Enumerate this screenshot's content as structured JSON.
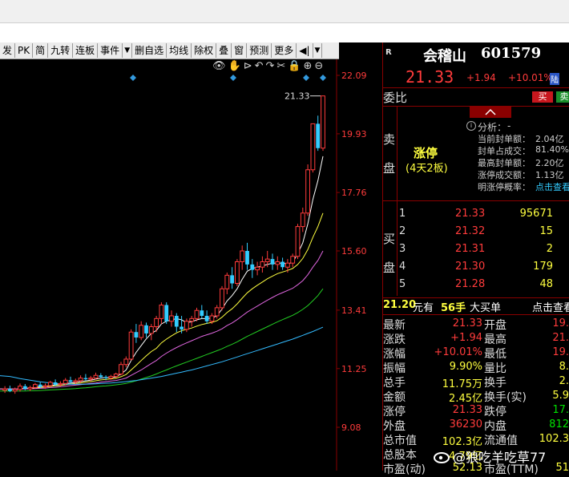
{
  "toolbar": {
    "items": [
      "发",
      "PK",
      "简",
      "九转",
      "连板",
      "事件",
      "▼",
      "删自选",
      "均线",
      "除权",
      "叠",
      "窗",
      "预测",
      "更多",
      "◀|",
      "▼"
    ]
  },
  "chart_tools": {
    "icons": [
      "eye-icon",
      "hand-icon",
      "play-icon",
      "undo-icon",
      "redo-icon",
      "scissors-icon",
      "lock-icon",
      "zoom-in-icon",
      "zoom-out-icon"
    ],
    "glyphs": [
      "👁",
      "✋",
      "⊳",
      "↶",
      "↷",
      "✂",
      "🔒",
      "⊕",
      "⊖"
    ]
  },
  "chart_data": {
    "type": "candlestick",
    "price_axis_ticks": [
      "22.09",
      "19.93",
      "17.76",
      "15.60",
      "13.41",
      "11.25",
      "9.08"
    ],
    "ylim": [
      9.08,
      22.09
    ],
    "high_label": "21.33",
    "candles": [
      {
        "o": 10.45,
        "h": 10.6,
        "l": 10.35,
        "c": 10.5
      },
      {
        "o": 10.5,
        "h": 10.62,
        "l": 10.38,
        "c": 10.42
      },
      {
        "o": 10.42,
        "h": 10.55,
        "l": 10.32,
        "c": 10.48
      },
      {
        "o": 10.48,
        "h": 10.7,
        "l": 10.4,
        "c": 10.6
      },
      {
        "o": 10.6,
        "h": 10.68,
        "l": 10.45,
        "c": 10.5
      },
      {
        "o": 10.5,
        "h": 10.62,
        "l": 10.42,
        "c": 10.55
      },
      {
        "o": 10.55,
        "h": 10.72,
        "l": 10.5,
        "c": 10.66
      },
      {
        "o": 10.66,
        "h": 10.75,
        "l": 10.52,
        "c": 10.58
      },
      {
        "o": 10.58,
        "h": 10.7,
        "l": 10.5,
        "c": 10.62
      },
      {
        "o": 10.62,
        "h": 10.8,
        "l": 10.55,
        "c": 10.74
      },
      {
        "o": 10.74,
        "h": 10.85,
        "l": 10.6,
        "c": 10.66
      },
      {
        "o": 10.66,
        "h": 10.78,
        "l": 10.58,
        "c": 10.7
      },
      {
        "o": 10.7,
        "h": 10.9,
        "l": 10.65,
        "c": 10.82
      },
      {
        "o": 10.82,
        "h": 10.95,
        "l": 10.7,
        "c": 10.76
      },
      {
        "o": 10.76,
        "h": 10.88,
        "l": 10.68,
        "c": 10.8
      },
      {
        "o": 10.8,
        "h": 11.0,
        "l": 10.72,
        "c": 10.9
      },
      {
        "o": 10.9,
        "h": 11.05,
        "l": 10.8,
        "c": 10.86
      },
      {
        "o": 10.86,
        "h": 10.98,
        "l": 10.78,
        "c": 10.9
      },
      {
        "o": 10.9,
        "h": 11.1,
        "l": 10.85,
        "c": 11.0
      },
      {
        "o": 11.0,
        "h": 11.08,
        "l": 10.88,
        "c": 10.94
      },
      {
        "o": 10.94,
        "h": 11.0,
        "l": 10.82,
        "c": 10.9
      },
      {
        "o": 10.9,
        "h": 11.02,
        "l": 10.84,
        "c": 10.96
      },
      {
        "o": 10.96,
        "h": 11.1,
        "l": 10.9,
        "c": 11.05
      },
      {
        "o": 11.05,
        "h": 11.5,
        "l": 11.0,
        "c": 11.4
      },
      {
        "o": 11.4,
        "h": 11.7,
        "l": 11.3,
        "c": 11.6
      },
      {
        "o": 11.6,
        "h": 12.7,
        "l": 11.55,
        "c": 12.6
      },
      {
        "o": 12.6,
        "h": 12.9,
        "l": 12.2,
        "c": 12.4
      },
      {
        "o": 12.4,
        "h": 13.0,
        "l": 12.3,
        "c": 12.85
      },
      {
        "o": 12.85,
        "h": 12.95,
        "l": 12.4,
        "c": 12.55
      },
      {
        "o": 12.55,
        "h": 12.9,
        "l": 12.3,
        "c": 12.8
      },
      {
        "o": 12.8,
        "h": 13.2,
        "l": 12.6,
        "c": 13.1
      },
      {
        "o": 13.1,
        "h": 13.7,
        "l": 12.9,
        "c": 13.6
      },
      {
        "o": 13.6,
        "h": 13.7,
        "l": 12.9,
        "c": 13.0
      },
      {
        "o": 13.0,
        "h": 13.4,
        "l": 12.8,
        "c": 13.2
      },
      {
        "o": 13.2,
        "h": 13.3,
        "l": 12.6,
        "c": 12.8
      },
      {
        "o": 12.8,
        "h": 13.2,
        "l": 12.55,
        "c": 12.7
      },
      {
        "o": 12.7,
        "h": 13.1,
        "l": 12.6,
        "c": 13.0
      },
      {
        "o": 13.0,
        "h": 13.2,
        "l": 12.8,
        "c": 13.1
      },
      {
        "o": 13.1,
        "h": 13.5,
        "l": 13.0,
        "c": 13.4
      },
      {
        "o": 13.4,
        "h": 13.6,
        "l": 13.1,
        "c": 13.2
      },
      {
        "o": 13.2,
        "h": 13.4,
        "l": 12.9,
        "c": 13.0
      },
      {
        "o": 13.0,
        "h": 13.3,
        "l": 12.9,
        "c": 13.2
      },
      {
        "o": 13.2,
        "h": 13.6,
        "l": 13.1,
        "c": 13.5
      },
      {
        "o": 13.5,
        "h": 14.3,
        "l": 13.4,
        "c": 14.2
      },
      {
        "o": 14.2,
        "h": 14.8,
        "l": 14.0,
        "c": 14.7
      },
      {
        "o": 14.7,
        "h": 15.0,
        "l": 14.2,
        "c": 14.4
      },
      {
        "o": 14.4,
        "h": 15.3,
        "l": 14.3,
        "c": 15.2
      },
      {
        "o": 15.2,
        "h": 15.8,
        "l": 14.9,
        "c": 15.6
      },
      {
        "o": 15.6,
        "h": 15.9,
        "l": 14.9,
        "c": 15.1
      },
      {
        "o": 15.1,
        "h": 15.3,
        "l": 14.6,
        "c": 14.9
      },
      {
        "o": 14.9,
        "h": 15.2,
        "l": 14.7,
        "c": 15.0
      },
      {
        "o": 15.0,
        "h": 15.4,
        "l": 14.8,
        "c": 15.2
      },
      {
        "o": 15.2,
        "h": 15.6,
        "l": 15.0,
        "c": 15.3
      },
      {
        "o": 15.3,
        "h": 15.5,
        "l": 14.9,
        "c": 15.1
      },
      {
        "o": 15.1,
        "h": 15.4,
        "l": 14.9,
        "c": 15.2
      },
      {
        "o": 15.2,
        "h": 15.35,
        "l": 14.9,
        "c": 15.0
      },
      {
        "o": 15.0,
        "h": 15.3,
        "l": 14.8,
        "c": 15.15
      },
      {
        "o": 15.15,
        "h": 15.5,
        "l": 15.0,
        "c": 15.4
      },
      {
        "o": 15.4,
        "h": 16.6,
        "l": 15.3,
        "c": 16.5
      },
      {
        "o": 16.5,
        "h": 17.2,
        "l": 16.3,
        "c": 17.0
      },
      {
        "o": 17.0,
        "h": 18.8,
        "l": 16.9,
        "c": 18.6
      },
      {
        "o": 18.6,
        "h": 20.3,
        "l": 18.5,
        "c": 20.3
      },
      {
        "o": 20.3,
        "h": 20.6,
        "l": 19.3,
        "c": 19.4
      },
      {
        "o": 19.4,
        "h": 21.33,
        "l": 19.3,
        "c": 21.33
      }
    ],
    "ma_lines": [
      {
        "color": "#ffffff",
        "values": [
          10.5,
          10.5,
          10.48,
          10.5,
          10.53,
          10.52,
          10.55,
          10.58,
          10.6,
          10.62,
          10.65,
          10.66,
          10.7,
          10.72,
          10.74,
          10.77,
          10.8,
          10.82,
          10.86,
          10.9,
          10.92,
          10.92,
          10.94,
          11.05,
          11.2,
          11.55,
          11.85,
          12.1,
          12.35,
          12.55,
          12.66,
          12.9,
          13.0,
          13.05,
          13.1,
          13.05,
          12.95,
          12.98,
          13.05,
          13.1,
          13.1,
          13.12,
          13.2,
          13.45,
          13.75,
          13.95,
          14.2,
          14.55,
          14.85,
          14.95,
          15.0,
          15.05,
          15.1,
          15.15,
          15.15,
          15.15,
          15.12,
          15.18,
          15.5,
          15.9,
          16.6,
          17.5,
          18.2,
          19.1
        ]
      },
      {
        "color": "#ffff3f",
        "values": [
          10.5,
          10.5,
          10.49,
          10.5,
          10.51,
          10.51,
          10.53,
          10.55,
          10.57,
          10.59,
          10.61,
          10.63,
          10.66,
          10.68,
          10.7,
          10.72,
          10.75,
          10.77,
          10.8,
          10.83,
          10.85,
          10.87,
          10.89,
          10.95,
          11.03,
          11.2,
          11.37,
          11.55,
          11.72,
          11.88,
          12.0,
          12.2,
          12.34,
          12.46,
          12.57,
          12.65,
          12.7,
          12.75,
          12.82,
          12.88,
          12.92,
          12.96,
          13.02,
          13.15,
          13.32,
          13.46,
          13.64,
          13.85,
          14.05,
          14.2,
          14.33,
          14.45,
          14.57,
          14.67,
          14.76,
          14.82,
          14.88,
          14.95,
          15.1,
          15.32,
          15.65,
          16.1,
          16.5,
          17.0
        ]
      },
      {
        "color": "#e066e0",
        "values": [
          10.5,
          10.5,
          10.5,
          10.5,
          10.5,
          10.5,
          10.51,
          10.52,
          10.53,
          10.55,
          10.56,
          10.58,
          10.6,
          10.62,
          10.64,
          10.66,
          10.68,
          10.7,
          10.72,
          10.75,
          10.77,
          10.79,
          10.81,
          10.85,
          10.9,
          11.0,
          11.1,
          11.2,
          11.32,
          11.44,
          11.55,
          11.7,
          11.82,
          11.93,
          12.03,
          12.12,
          12.2,
          12.28,
          12.36,
          12.44,
          12.5,
          12.56,
          12.63,
          12.72,
          12.84,
          12.94,
          13.06,
          13.2,
          13.34,
          13.45,
          13.56,
          13.67,
          13.78,
          13.88,
          13.98,
          14.06,
          14.14,
          14.22,
          14.35,
          14.5,
          14.72,
          15.0,
          15.25,
          15.6
        ]
      },
      {
        "color": "#22cc22",
        "values": [
          10.42,
          10.42,
          10.42,
          10.42,
          10.42,
          10.43,
          10.43,
          10.44,
          10.45,
          10.46,
          10.47,
          10.48,
          10.49,
          10.5,
          10.51,
          10.53,
          10.54,
          10.56,
          10.58,
          10.6,
          10.61,
          10.63,
          10.65,
          10.67,
          10.7,
          10.75,
          10.8,
          10.86,
          10.92,
          10.98,
          11.05,
          11.13,
          11.2,
          11.28,
          11.35,
          11.42,
          11.49,
          11.56,
          11.63,
          11.7,
          11.77,
          11.84,
          11.91,
          11.98,
          12.07,
          12.15,
          12.24,
          12.34,
          12.44,
          12.53,
          12.62,
          12.71,
          12.8,
          12.89,
          12.98,
          13.06,
          13.14,
          13.22,
          13.32,
          13.44,
          13.58,
          13.76,
          13.95,
          14.2
        ]
      },
      {
        "color": "#33bbff",
        "values": [
          11.0,
          10.96,
          10.92,
          10.88,
          10.85,
          10.82,
          10.79,
          10.76,
          10.74,
          10.72,
          10.7,
          10.69,
          10.68,
          10.67,
          10.67,
          10.67,
          10.67,
          10.68,
          10.69,
          10.7,
          10.71,
          10.72,
          10.73,
          10.75,
          10.77,
          10.79,
          10.81,
          10.84,
          10.87,
          10.9,
          10.93,
          10.96,
          11.0,
          11.04,
          11.08,
          11.12,
          11.16,
          11.2,
          11.25,
          11.3,
          11.35,
          11.4,
          11.45,
          11.5,
          11.56,
          11.62,
          11.68,
          11.74,
          11.8,
          11.86,
          11.92,
          11.98,
          12.04,
          12.1,
          12.16,
          12.22,
          12.28,
          12.34,
          12.41,
          12.48,
          12.55,
          12.62,
          12.7,
          12.78
        ]
      }
    ]
  },
  "quote": {
    "tag": "R",
    "name": "会稽山",
    "code": "601579",
    "price": "21.33",
    "change": "+1.94",
    "change_pct": "+10.01%",
    "lu_tag": "陆"
  },
  "weibi": {
    "label": "委比",
    "buy": "买",
    "sell": "卖"
  },
  "sell_side": {
    "label_1": "卖",
    "label_2": "盘",
    "limit_title": "涨停",
    "limit_sub": "(4天2板)",
    "analysis_label": "分析：",
    "analysis_value": "-",
    "metrics": [
      {
        "label": "当前封单额：",
        "value": "2.04亿"
      },
      {
        "label": "封单占成交：",
        "value": "81.40%"
      },
      {
        "label": "最高封单额：",
        "value": "2.20亿"
      },
      {
        "label": "涨停成交额：",
        "value": "1.13亿"
      },
      {
        "label": "明涨停概率：",
        "value": "点击查看"
      }
    ]
  },
  "buy_side": {
    "label_1": "买",
    "label_2": "盘",
    "levels": [
      {
        "n": "1",
        "price": "21.33",
        "vol": "95671"
      },
      {
        "n": "2",
        "price": "21.32",
        "vol": "15"
      },
      {
        "n": "3",
        "price": "21.31",
        "vol": "2"
      },
      {
        "n": "4",
        "price": "21.30",
        "vol": "179"
      },
      {
        "n": "5",
        "price": "21.28",
        "vol": "48"
      }
    ]
  },
  "big_order": {
    "price": "21.20",
    "unit": "元有",
    "hands": "56手",
    "desc": "大买单",
    "link": "点击查看"
  },
  "stats_left": [
    {
      "label": "最新",
      "value": "21.33",
      "cls": "red"
    },
    {
      "label": "涨跌",
      "value": "+1.94",
      "cls": "red"
    },
    {
      "label": "涨幅",
      "value": "+10.01%",
      "cls": "red"
    },
    {
      "label": "振幅",
      "value": "9.90%",
      "cls": "yel"
    },
    {
      "label": "总手",
      "value": "11.75万",
      "cls": "yel"
    },
    {
      "label": "金额",
      "value": "2.45亿",
      "cls": "yel"
    },
    {
      "label": "涨停",
      "value": "21.33",
      "cls": "red"
    },
    {
      "label": "外盘",
      "value": "36230",
      "cls": "red"
    },
    {
      "label": "总市值",
      "value": "102.3亿",
      "cls": "yel"
    },
    {
      "label": "总股本",
      "value": "4.79亿",
      "cls": "yel"
    },
    {
      "label": "市盈(动)",
      "value": "52.13",
      "cls": "yel"
    }
  ],
  "stats_right": [
    {
      "label": "开盘",
      "value": "19.",
      "cls": "red"
    },
    {
      "label": "最高",
      "value": "21.",
      "cls": "red"
    },
    {
      "label": "最低",
      "value": "19.",
      "cls": "red"
    },
    {
      "label": "量比",
      "value": "8.",
      "cls": "yel"
    },
    {
      "label": "换手",
      "value": "2.",
      "cls": "yel"
    },
    {
      "label": "换手(实)",
      "value": "5.9",
      "cls": "yel"
    },
    {
      "label": "跌停",
      "value": "17.",
      "cls": "grn"
    },
    {
      "label": "内盘",
      "value": "812",
      "cls": "grn"
    },
    {
      "label": "流通值",
      "value": "102.3",
      "cls": "yel"
    },
    {
      "label": "",
      "value": "",
      "cls": "yel"
    },
    {
      "label": "市盈(TTM)",
      "value": "51",
      "cls": "yel"
    }
  ],
  "watermark": "@狼吃羊吃草77"
}
